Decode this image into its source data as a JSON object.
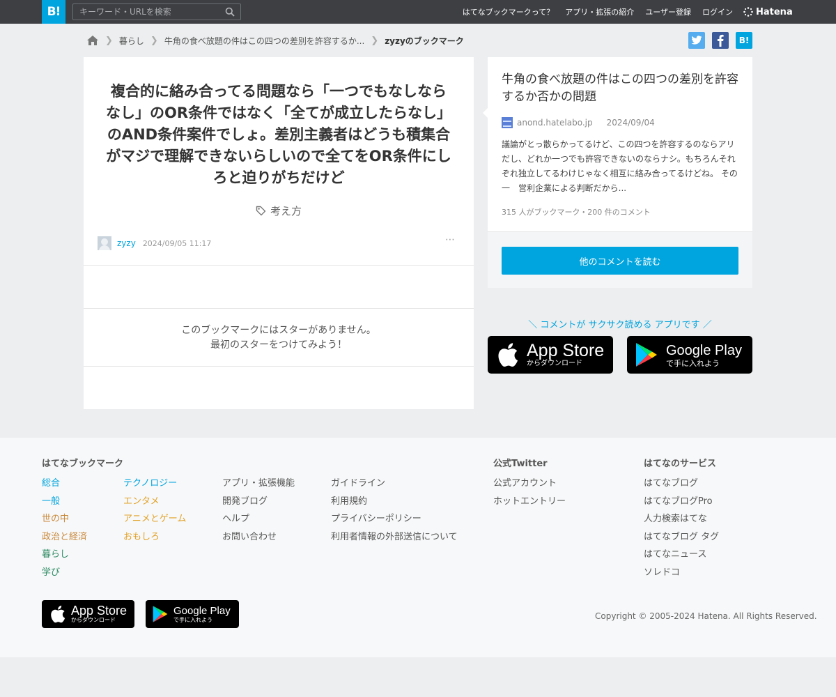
{
  "topbar": {
    "logo": "B!",
    "search_placeholder": "キーワード・URLを検索",
    "nav": [
      "はてなブックマークって？",
      "アプリ・拡張の紹介",
      "ユーザー登録",
      "ログイン"
    ],
    "brand": "Hatena"
  },
  "breadcrumb": {
    "items": [
      "暮らし",
      "牛角の食べ放題の件はこの四つの差別を許容するか..."
    ],
    "current": "zyzyのブックマーク"
  },
  "share": {
    "hatena": "B!",
    "twitter_color": "#55acee",
    "facebook_color": "#3b5998",
    "hatena_color": "#00a4de"
  },
  "bookmark": {
    "comment": "複合的に絡み合ってる問題なら「一つでもなしならなし」のOR条件ではなく「全てが成立したらなし」のAND条件案件でしょ。差別主義者はどうも積集合がマジで理解できないらしいので全てをOR条件にしろと迫りがちだけど",
    "tag": "考え方",
    "user": "zyzy",
    "date": "2024/09/05 11:17",
    "more": "⋯",
    "no_star_line1": "このブックマークにはスターがありません。",
    "no_star_line2": "最初のスターをつけてみよう！"
  },
  "entry": {
    "title": "牛角の食べ放題の件はこの四つの差別を許容するか否かの問題",
    "domain": "anond.hatelabo.jp",
    "date": "2024/09/04",
    "excerpt": "議論がとっ散らかってるけど、この四つを許容するのならアリだし、どれか一つでも許容できないのならナシ。もちろんそれぞれ独立してるわけじゃなく相互に絡み合ってるけどね。 その一　営利企業による判断だから...",
    "stats": "315 人がブックマーク・200 件のコメント",
    "read_button": "他のコメントを読む"
  },
  "app_promo": {
    "caption": "＼ コメントが サクサク読める アプリです ／",
    "appstore_big": "App Store",
    "appstore_small": "からダウンロード",
    "googleplay_big": "Google Play",
    "googleplay_small": "で手に入れよう"
  },
  "footer": {
    "heading_bookmark": "はてなブックマーク",
    "categories_col1": [
      "総合",
      "一般",
      "世の中",
      "政治と経済",
      "暮らし",
      "学び"
    ],
    "categories_col2": [
      "テクノロジー",
      "エンタメ",
      "アニメとゲーム",
      "おもしろ"
    ],
    "links_col3": [
      "アプリ・拡張機能",
      "開発ブログ",
      "ヘルプ",
      "お問い合わせ"
    ],
    "links_col4": [
      "ガイドライン",
      "利用規約",
      "プライバシーポリシー",
      "利用者情報の外部送信について"
    ],
    "heading_twitter": "公式Twitter",
    "twitter_links": [
      "公式アカウント",
      "ホットエントリー"
    ],
    "heading_services": "はてなのサービス",
    "services": [
      "はてなブログ",
      "はてなブログPro",
      "人力検索はてな",
      "はてなブログ タグ",
      "はてなニュース",
      "ソレドコ"
    ],
    "copyright": "Copyright © 2005-2024 Hatena. All Rights Reserved.",
    "category_colors": {
      "総合": "#00a4de",
      "一般": "#00a4de",
      "世の中": "#c9893c",
      "政治と経済": "#c9893c",
      "暮らし": "#2b8a62",
      "学び": "#2b8a62",
      "テクノロジー": "#00a4de",
      "エンタメ": "#e2a228",
      "アニメとゲーム": "#e2a228",
      "おもしろ": "#e2a228"
    }
  }
}
